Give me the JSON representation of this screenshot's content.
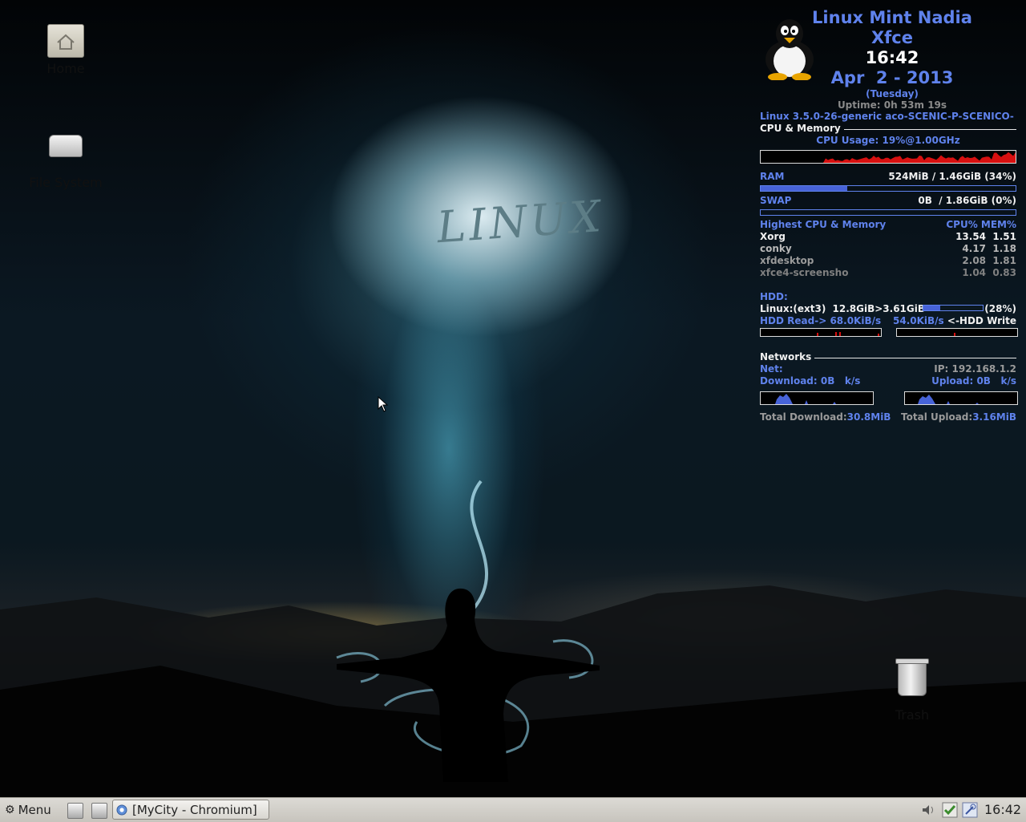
{
  "desktop": {
    "icons": [
      {
        "name": "home-folder-icon",
        "label": "Home"
      },
      {
        "name": "file-system-icon",
        "label": "File System"
      },
      {
        "name": "trash-icon",
        "label": "Trash"
      }
    ]
  },
  "conky": {
    "distro": "Linux Mint Nadia",
    "desktop_env": "Xfce",
    "time": "16:42",
    "date": "Apr  2 - 2013",
    "weekday": "(Tuesday)",
    "uptime": "Uptime: 0h 53m 19s",
    "kernel": "Linux 3.5.0-26-generic aco-SCENIC-P-SCENICO-",
    "cpu_mem_header": "CPU & Memory",
    "cpu_usage": "CPU Usage: 19%@1.00GHz",
    "cpu_graph_level": 0.19,
    "ram_label": "RAM",
    "ram_value": "524MiB / 1.46GiB (34%)",
    "ram_fraction": 0.34,
    "swap_label": "SWAP",
    "swap_value": "0B  / 1.86GiB (0%)",
    "swap_fraction": 0.0,
    "top_header": "Highest CPU & Memory",
    "top_columns": "CPU% MEM%",
    "processes": [
      {
        "name": "Xorg",
        "values": "13.54  1.51"
      },
      {
        "name": "conky",
        "values": "4.17  1.18"
      },
      {
        "name": "xfdesktop",
        "values": "2.08  1.81"
      },
      {
        "name": "xfce4-screensho",
        "values": "1.04  0.83"
      }
    ],
    "hdd_header": "HDD:",
    "hdd_line_label": "Linux:(ext3)",
    "hdd_line_value": "12.8GiB>3.61GiB",
    "hdd_percent": "(28%)",
    "hdd_fraction": 0.28,
    "hdd_read_label": "HDD Read->",
    "hdd_read_value": "68.0KiB/s",
    "hdd_write_value": "54.0KiB/s",
    "hdd_write_label": "<-HDD Write",
    "net_header": "Networks",
    "net_label": "Net:",
    "ip": "IP: 192.168.1.2",
    "download_label": "Download:",
    "download_value": "0B   k/s",
    "upload_label": "Upload:",
    "upload_value": "0B   k/s",
    "total_download_label": "Total Download:",
    "total_download_value": "30.8MiB",
    "total_upload_label": "Total Upload:",
    "total_upload_value": "3.16MiB",
    "colors": {
      "blue": "#5f82ec",
      "red": "#d81010",
      "white": "#f0f0f0"
    }
  },
  "taskbar": {
    "menu_label": "Menu",
    "menu_icon": "gear-icon",
    "task_label": "[MyCity - Chromium]",
    "task_icon": "chromium-icon",
    "tray_icons": [
      "volume-icon",
      "update-shield-icon",
      "network-tool-icon"
    ],
    "clock": "16:42"
  }
}
